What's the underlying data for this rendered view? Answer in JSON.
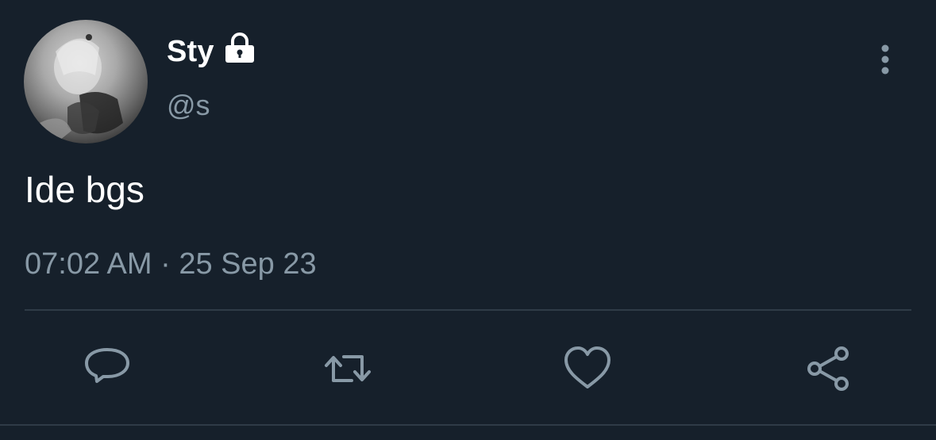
{
  "tweet": {
    "display_name": "Sty",
    "handle": "@s",
    "text": "Ide bgs",
    "timestamp": "07:02 AM · 25 Sep 23",
    "protected": true
  },
  "icons": {
    "lock": "lock-icon",
    "more": "more-vertical-icon",
    "reply": "reply-icon",
    "retweet": "retweet-icon",
    "like": "heart-icon",
    "share": "share-icon"
  },
  "colors": {
    "background": "#16202b",
    "text_primary": "#ffffff",
    "text_secondary": "#8899a6",
    "divider": "#2f3b47"
  }
}
